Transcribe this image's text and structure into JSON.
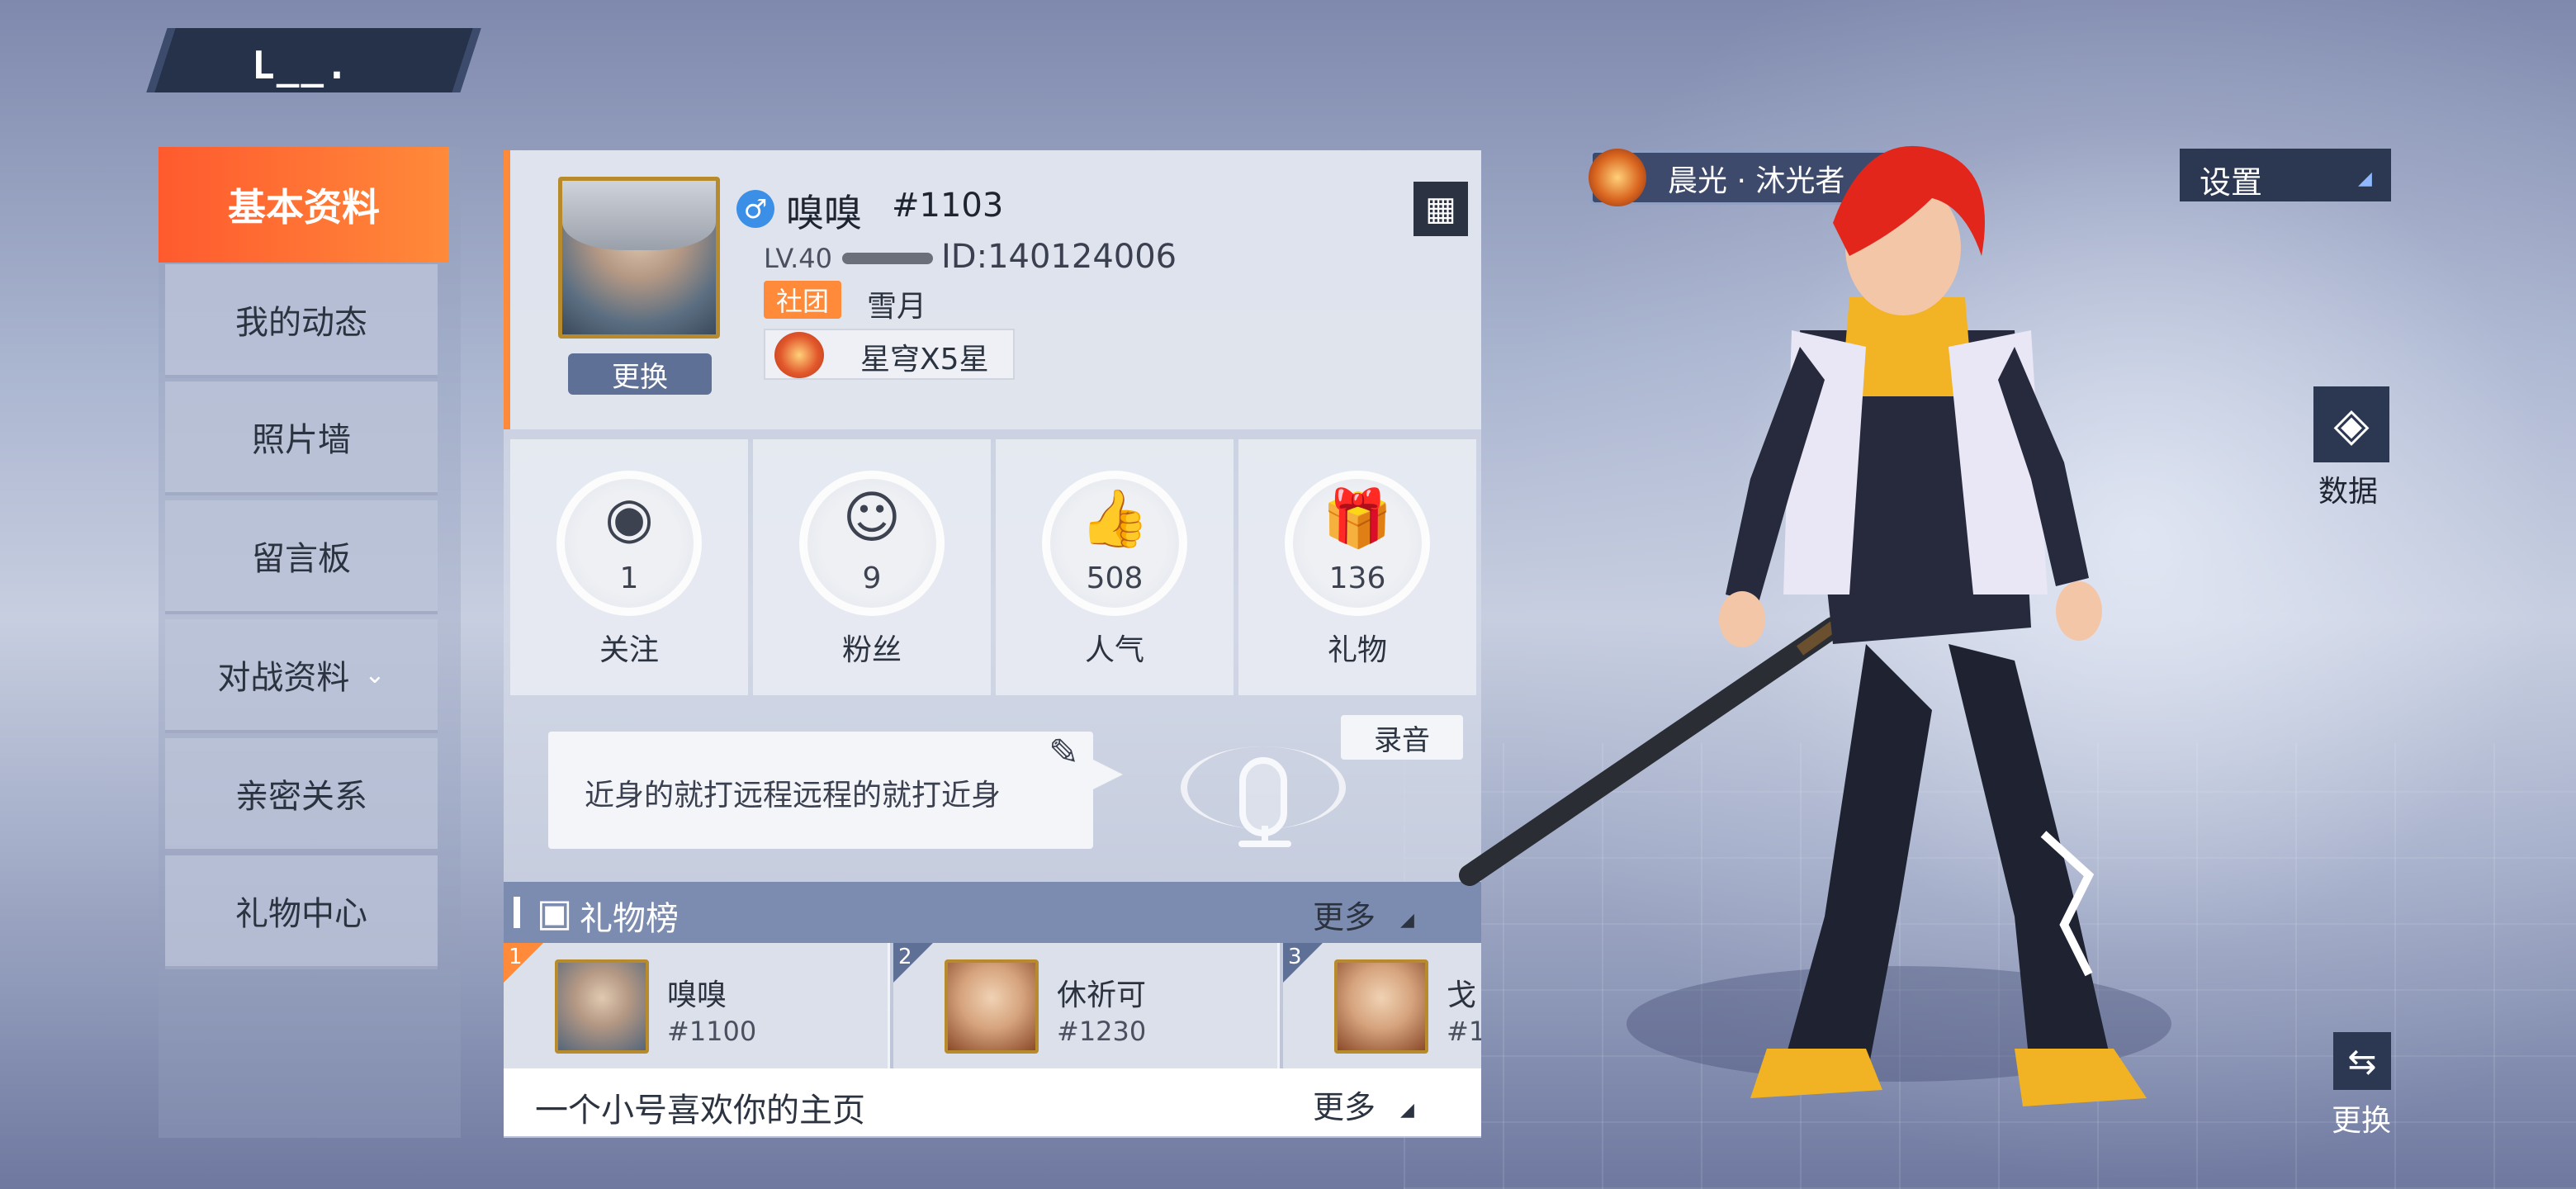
{
  "header": {
    "banner_mark": "L__."
  },
  "sidebar": {
    "items": [
      {
        "label": "基本资料"
      },
      {
        "label": "我的动态"
      },
      {
        "label": "照片墙"
      },
      {
        "label": "留言板"
      },
      {
        "label": "对战资料"
      },
      {
        "label": "亲密关系"
      },
      {
        "label": "礼物中心"
      }
    ]
  },
  "profile": {
    "name": "嗅嗅",
    "tag": "#1103",
    "gender_symbol": "♂",
    "level": "LV.40",
    "id_text": "ID:140124006",
    "club_label": "社团",
    "club_name": "雪月",
    "rank_text": "星穹X5星",
    "change_label": "更换",
    "level_progress": 0.5
  },
  "stats": [
    {
      "icon": "eye-icon",
      "value": "1",
      "label": "关注"
    },
    {
      "icon": "fans-icon",
      "value": "9",
      "label": "粉丝"
    },
    {
      "icon": "thumbs-up-icon",
      "value": "508",
      "label": "人气"
    },
    {
      "icon": "gift-icon",
      "value": "136",
      "label": "礼物"
    }
  ],
  "signature": {
    "text": "近身的就打远程远程的就打近身",
    "record_label": "录音"
  },
  "gift_board": {
    "title": "礼物榜",
    "more_label": "更多",
    "entries": [
      {
        "rank": "1",
        "name": "嗅嗅",
        "id": "#1100",
        "badge_color": "#ff8a3a"
      },
      {
        "rank": "2",
        "name": "休祈可",
        "id": "#1230",
        "badge_color": "#5f7097"
      },
      {
        "rank": "3",
        "name": "戈",
        "id": "#1",
        "badge_color": "#5f7097"
      }
    ]
  },
  "visit": {
    "text": "一个小号喜欢你的主页",
    "more_label": "更多"
  },
  "right": {
    "title_text": "晨光 · 沐光者",
    "settings_label": "设置",
    "data_label": "数据",
    "swap_label": "更换"
  },
  "colors": {
    "accent": "#ff5a2e",
    "panel_header": "#7c8cb0",
    "dark_button": "#2c3852"
  }
}
